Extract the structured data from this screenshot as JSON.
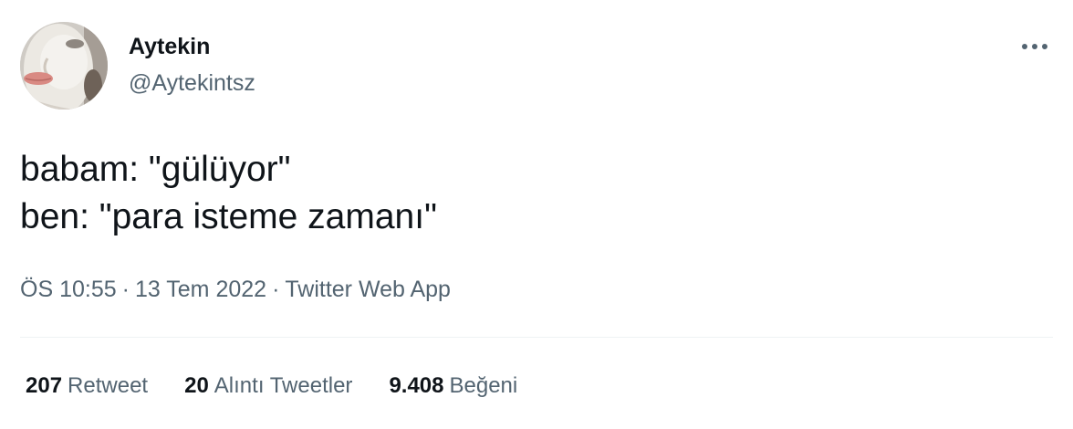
{
  "author": {
    "display_name": "Aytekin",
    "handle": "@Aytekintsz"
  },
  "tweet": {
    "lines": [
      "babam: \"gülüyor\"",
      "ben: \"para isteme zamanı\""
    ]
  },
  "meta": {
    "time": "ÖS 10:55",
    "separator": "·",
    "date": "13 Tem 2022",
    "source": "Twitter Web App"
  },
  "stats": {
    "retweets_count": "207",
    "retweets_label": "Retweet",
    "quotes_count": "20",
    "quotes_label": "Alıntı Tweetler",
    "likes_count": "9.408",
    "likes_label": "Beğeni"
  },
  "icons": {
    "more": "more-dots-icon"
  },
  "colors": {
    "text_primary": "#0f1419",
    "text_secondary": "#536471",
    "divider": "#eff3f4",
    "background": "#ffffff"
  }
}
